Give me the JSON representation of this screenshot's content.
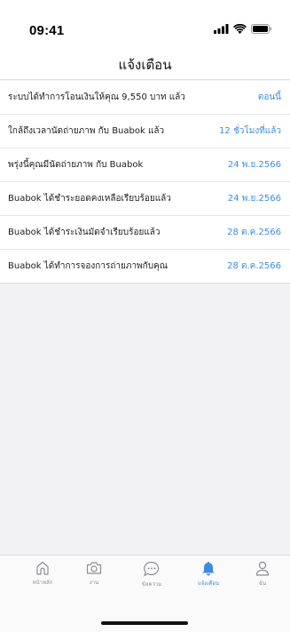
{
  "status_bar": {
    "time": "09:41"
  },
  "header": {
    "title": "แจ้งเตือน"
  },
  "notifications": [
    {
      "text": "ระบบได้ทำการโอนเงินให้คุณ 9,550 บาท แล้ว",
      "date": "ตอนนี้"
    },
    {
      "text": "ใกล้ถึงเวลานัดถ่ายภาพ กับ Buabok  แล้ว",
      "date": "12 ชั่วโมงที่แล้ว"
    },
    {
      "text": "พรุ่งนี้คุณมีนัดถ่ายภาพ กับ Buabok",
      "date": "24 พ.ย.2566"
    },
    {
      "text": "Buabok ได้ชำระยอดคงเหลือเรียบร้อยแล้ว",
      "date": "24 พ.ย.2566"
    },
    {
      "text": "Buabok ได้ชำระเงินมัดจำเรียบร้อยแล้ว",
      "date": "28 ต.ค.2566"
    },
    {
      "text": "Buabok ได้ทำการจองการถ่ายภาพกับคุณ",
      "date": "28 ต.ค.2566"
    }
  ],
  "tabbar": {
    "active_color": "#3d8bdf",
    "inactive_color": "#8e8e93",
    "items": [
      {
        "label": "หน้าหลัก",
        "icon": "home-icon"
      },
      {
        "label": "งาน",
        "icon": "camera-icon"
      },
      {
        "label": "ข้อความ",
        "icon": "chat-icon"
      },
      {
        "label": "แจ้งเตือน",
        "icon": "bell-icon",
        "active": true
      },
      {
        "label": "ฉัน",
        "icon": "person-icon"
      }
    ]
  }
}
